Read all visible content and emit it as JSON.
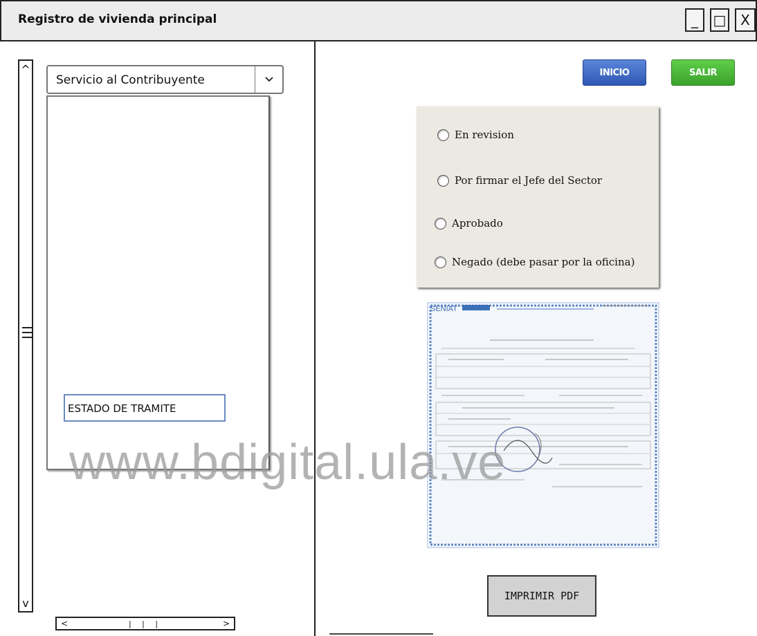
{
  "window": {
    "title": "Registro de vivienda principal",
    "controls": [
      "_",
      "□",
      "X"
    ]
  },
  "left_panel": {
    "dropdown": {
      "selected": "Servicio al Contribuyente",
      "button_icon": "chevron-down-icon"
    },
    "estado_input": {
      "value": "ESTADO DE TRAMITE"
    },
    "vscroll": {
      "up": "^",
      "down": "v"
    },
    "hscroll": {
      "left": "<",
      "right": ">",
      "thumb": "| | |"
    }
  },
  "right_panel": {
    "buttons": {
      "inicio": "INICIO",
      "salir": "SALIR",
      "pdf": "IMPRIMIR PDF"
    },
    "status_options": [
      "En revision",
      "Por firmar el Jefe del Sector",
      "Aprobado",
      "Negado (debe pasar por la oficina)"
    ],
    "document": {
      "header_logo": "SENIAT"
    }
  },
  "watermark": "www.bdigital.ula.ve",
  "colors": {
    "inicio": "#3a66c4",
    "salir": "#48b534",
    "panel_bg": "#ece9e3"
  }
}
